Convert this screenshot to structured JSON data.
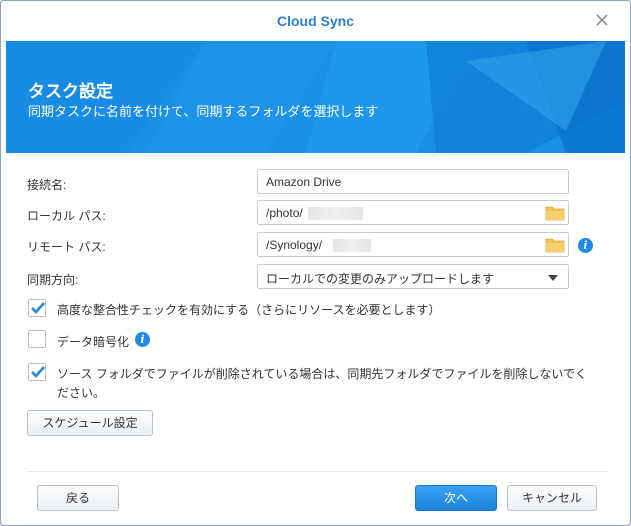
{
  "window": {
    "title": "Cloud Sync"
  },
  "banner": {
    "title": "タスク設定",
    "subtitle": "同期タスクに名前を付けて、同期するフォルダを選択します"
  },
  "form": {
    "connection_label": "接続名:",
    "connection_value": "Amazon Drive",
    "local_path_label": "ローカル パス:",
    "local_path_value": "/photo/",
    "remote_path_label": "リモート パス:",
    "remote_path_value": "/Synology/",
    "direction_label": "同期方向:",
    "direction_value": "ローカルでの変更のみアップロードします"
  },
  "options": {
    "advanced_check": {
      "label": "高度な整合性チェックを有効にする（さらにリソースを必要とします）",
      "checked": true
    },
    "encryption": {
      "label": "データ暗号化",
      "checked": false
    },
    "keep_deleted": {
      "label_line1": "ソース フォルダでファイルが削除されている場合は、同期先フォルダでファイルを削除しないでく",
      "label_line2": "ださい。",
      "checked": true
    }
  },
  "buttons": {
    "schedule": "スケジュール設定",
    "back": "戻る",
    "next": "次へ",
    "cancel": "キャンセル"
  },
  "colors": {
    "accent": "#1a8fe6",
    "title": "#2a7fd6",
    "folder": "#f2c255",
    "check": "#1f8ae6"
  }
}
